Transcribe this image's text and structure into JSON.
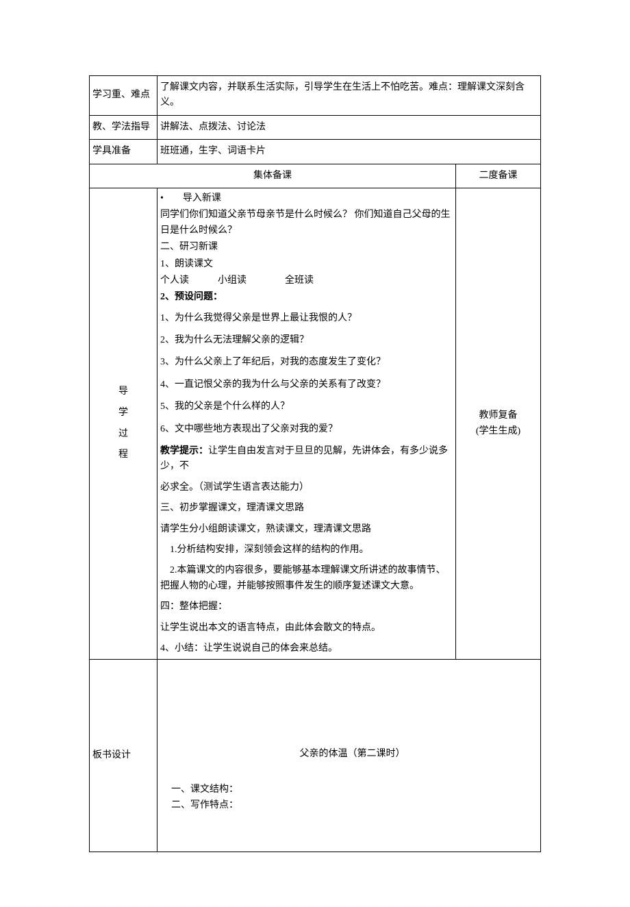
{
  "rows": {
    "focus": {
      "label": "学习重、难点",
      "text": "了解课文内容，并联系生活实际，引导学生在生活上不怕吃苦。难点：理解课文深刻含义。"
    },
    "method": {
      "label": "教、学法指导",
      "text": "讲解法、点拨法、讨论法"
    },
    "tools": {
      "label": "学具准备",
      "text": "班班通，生字、词语卡片"
    }
  },
  "section": {
    "groupPrep": "集体备课",
    "secondPrep": "二度备课"
  },
  "process": {
    "label": "导学过程",
    "intro1": "•　　导入新课",
    "intro2": "同学们你们知道父亲节母亲节是什么时候么？  你们知道自己父母的生日是什么时候么？",
    "study": "二、研习新课",
    "read1": "1、朗读课文",
    "read2": "个人读　　　小组读　　　　全班读",
    "preset": "2、预设问题：",
    "q1": "1、为什么我觉得父亲是世界上最让我恨的人？",
    "q2": "2、我为什么无法理解父亲的逻辑？",
    "q3": "3、为什么父亲上了年纪后，对我的态度发生了变化？",
    "q4": "4、一直记恨父亲的我为什么与父亲的关系有了改变？",
    "q5": "5、我的父亲是个什么样的人？",
    "q6": "6、文中哪些地方表现出了父亲对我的爱？",
    "hintLabel": "教学提示：",
    "hintText": "让学生自由发言对于旦旦的见解，先讲体会，有多少说多少，不",
    "hintCont": "必求全。（测试学生语言表达能力）",
    "three": "三、初步掌握课文，理清课文思路",
    "threeSub": "请学生分小组朗读课文，熟读课文，理清课文思路",
    "p1": "　1.分析结构安排，深刻领会这样的结构的作用。",
    "p2": "　2.本篇课文的内容很多，要能够基本理解课文所讲述的故事情节、把握人物的心理，并能够按照事件发生的顺序复述课文大意。",
    "four": "四：整体把握：",
    "fourSub": "让学生说出本文的语言特点，由此体会散文的特点。",
    "summary": "4、小结：让学生说说自己的体会来总结。",
    "rightNote1": "教师复备",
    "rightNote2": "(学生生成)"
  },
  "board": {
    "label": "板书设计",
    "title": "父亲的体温（第二课时）",
    "line1": "一、课文结构：",
    "line2": "二、写作特点："
  }
}
